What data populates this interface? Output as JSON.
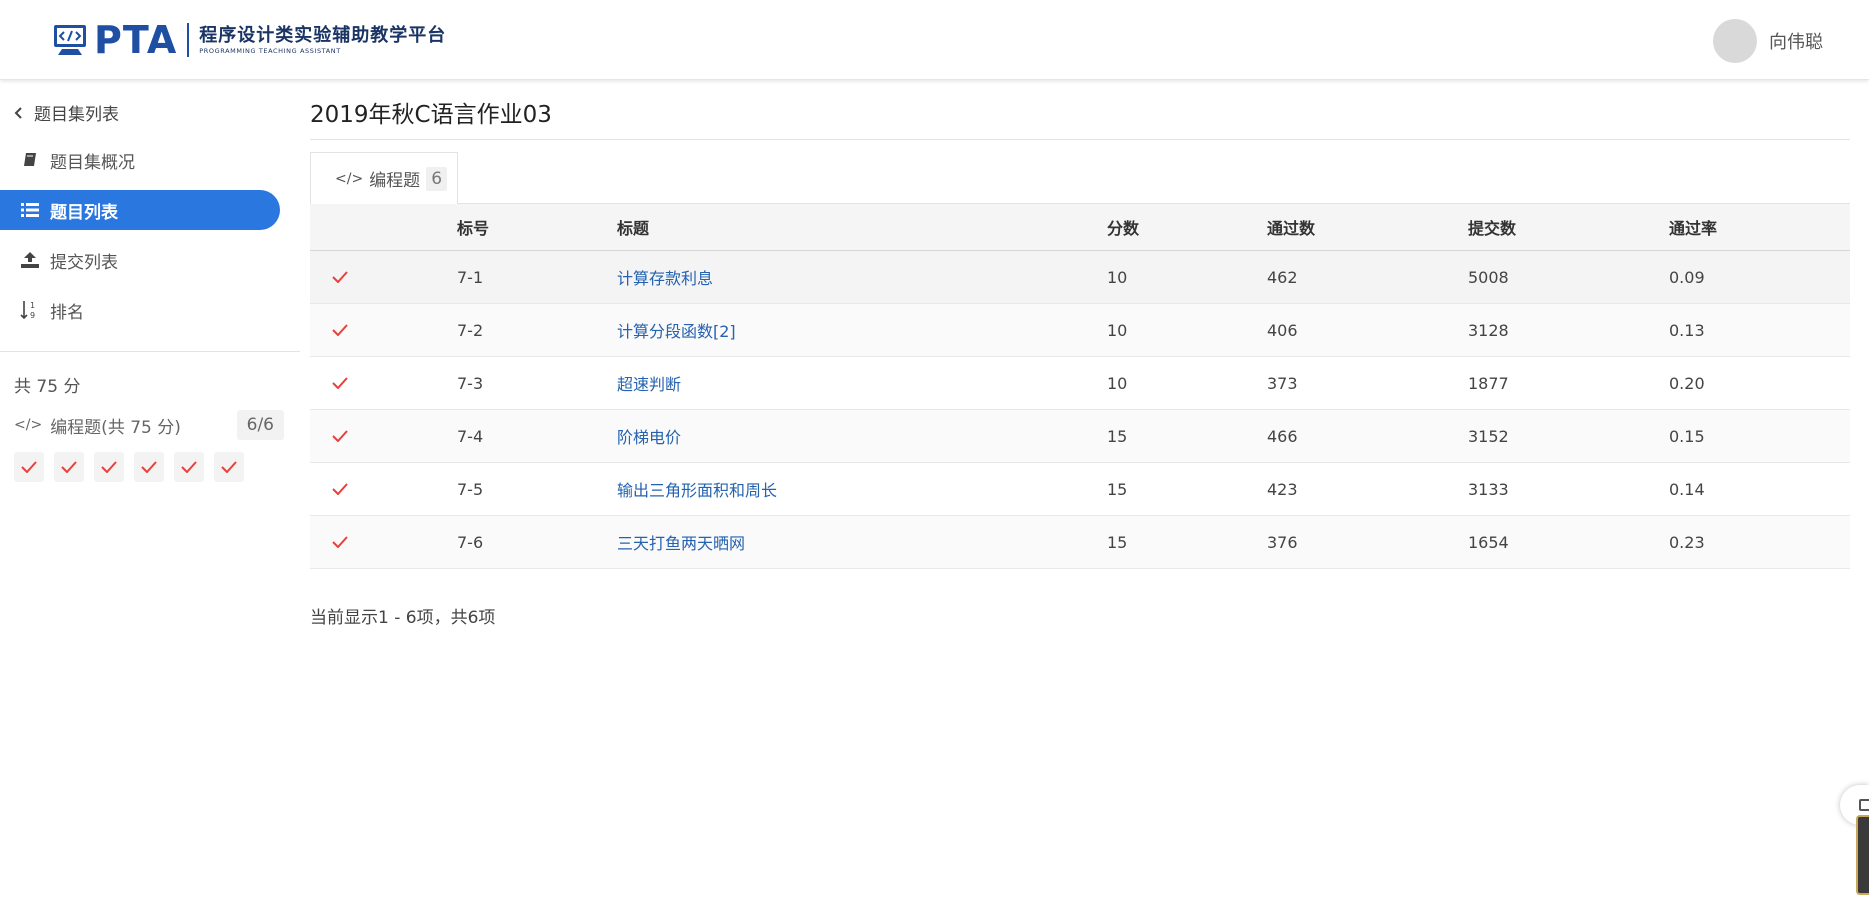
{
  "header": {
    "logo_pta": "PTA",
    "logo_cn": "程序设计类实验辅助教学平台",
    "logo_en": "PROGRAMMING TEACHING ASSISTANT",
    "user_name": "向伟聪"
  },
  "sidebar": {
    "back_label": "题目集列表",
    "items": [
      {
        "label": "题目集概况",
        "icon": "book-icon"
      },
      {
        "label": "题目列表",
        "icon": "list-icon",
        "active": true
      },
      {
        "label": "提交列表",
        "icon": "upload-icon"
      },
      {
        "label": "排名",
        "icon": "sort-numeric-icon"
      }
    ],
    "total_score": "共 75 分",
    "section_label": "编程题(共 75 分)",
    "section_count": "6/6",
    "marks_count": 6
  },
  "main": {
    "title": "2019年秋C语言作业03",
    "tab": {
      "label": "编程题",
      "count": "6"
    },
    "columns": [
      "",
      "标号",
      "标题",
      "分数",
      "通过数",
      "提交数",
      "通过率"
    ],
    "rows": [
      {
        "status": "accepted",
        "id": "7-1",
        "title": "计算存款利息",
        "score": "10",
        "accepted": "462",
        "submitted": "5008",
        "rate": "0.09"
      },
      {
        "status": "accepted",
        "id": "7-2",
        "title": "计算分段函数[2]",
        "score": "10",
        "accepted": "406",
        "submitted": "3128",
        "rate": "0.13"
      },
      {
        "status": "accepted",
        "id": "7-3",
        "title": "超速判断",
        "score": "10",
        "accepted": "373",
        "submitted": "1877",
        "rate": "0.20"
      },
      {
        "status": "accepted",
        "id": "7-4",
        "title": "阶梯电价",
        "score": "15",
        "accepted": "466",
        "submitted": "3152",
        "rate": "0.15"
      },
      {
        "status": "accepted",
        "id": "7-5",
        "title": "输出三角形面积和周长",
        "score": "15",
        "accepted": "423",
        "submitted": "3133",
        "rate": "0.14"
      },
      {
        "status": "accepted",
        "id": "7-6",
        "title": "三天打鱼两天晒网",
        "score": "15",
        "accepted": "376",
        "submitted": "1654",
        "rate": "0.23"
      }
    ],
    "footer": "当前显示1 - 6项，共6项"
  },
  "colors": {
    "brand": "#1f4fa3",
    "active_nav": "#2a77e0",
    "link": "#2562b0",
    "check": "#e8403a"
  }
}
